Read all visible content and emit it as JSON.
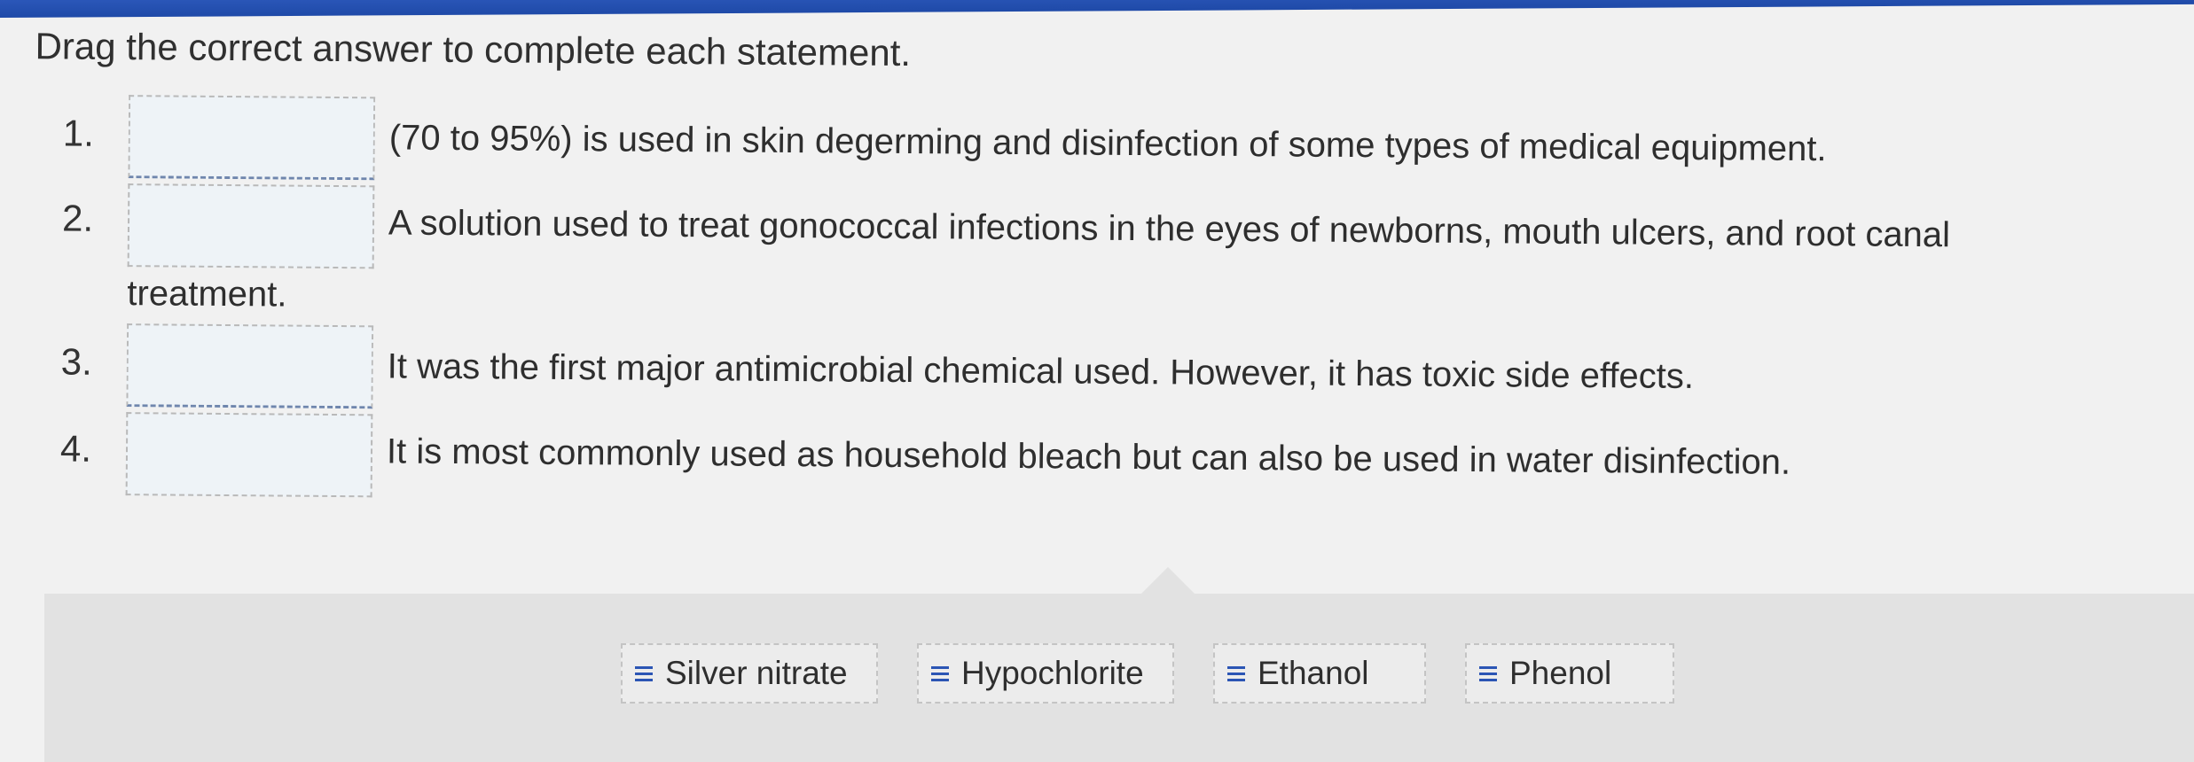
{
  "instruction": "Drag the correct answer to complete each statement.",
  "statements": [
    {
      "number": "1.",
      "text": "(70 to 95%) is used in skin degerming and disinfection of some types of medical equipment."
    },
    {
      "number": "2.",
      "text": "A solution used to treat gonococcal infections in the eyes of newborns, mouth ulcers, and root canal",
      "continuation": "treatment."
    },
    {
      "number": "3.",
      "text": "It was the first major antimicrobial chemical used. However, it has toxic side effects."
    },
    {
      "number": "4.",
      "text": "It is most commonly used as household bleach but can also be used in water disinfection."
    }
  ],
  "answers": [
    {
      "label": "Silver nitrate",
      "icon": "drag-handle-icon"
    },
    {
      "label": "Hypochlorite",
      "icon": "drag-handle-icon"
    },
    {
      "label": "Ethanol",
      "icon": "drag-handle-icon"
    },
    {
      "label": "Phenol",
      "icon": "drag-handle-icon"
    }
  ],
  "colors": {
    "accent": "#2b55b4",
    "drop_zone_fill": "#eef3f7",
    "tray": "#e2e2e2"
  }
}
